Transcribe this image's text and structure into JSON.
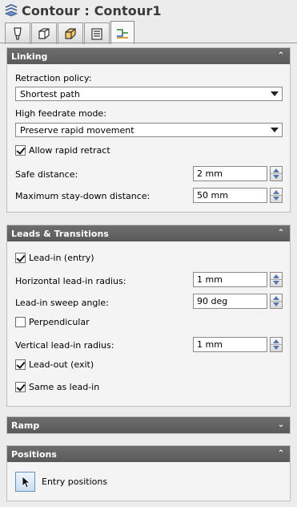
{
  "title": "Contour : Contour1",
  "tabs": [
    {
      "icon": "tool-icon",
      "active": false
    },
    {
      "icon": "stock-box-icon",
      "active": false
    },
    {
      "icon": "box-outline-icon",
      "active": false
    },
    {
      "icon": "passes-icon",
      "active": false
    },
    {
      "icon": "linking-icon",
      "active": true
    }
  ],
  "linking": {
    "header": "Linking",
    "retraction_label": "Retraction policy:",
    "retraction_value": "Shortest path",
    "high_feed_label": "High feedrate mode:",
    "high_feed_value": "Preserve rapid movement",
    "allow_rapid_label": "Allow rapid retract",
    "allow_rapid_checked": true,
    "safe_distance_label": "Safe distance:",
    "safe_distance_value": "2 mm",
    "max_stay_label": "Maximum stay-down distance:",
    "max_stay_value": "50 mm"
  },
  "leads": {
    "header": "Leads & Transitions",
    "lead_in_label": "Lead-in (entry)",
    "lead_in_checked": true,
    "h_radius_label": "Horizontal lead-in radius:",
    "h_radius_value": "1 mm",
    "sweep_label": "Lead-in sweep angle:",
    "sweep_value": "90 deg",
    "perpendicular_label": "Perpendicular",
    "perpendicular_checked": false,
    "v_radius_label": "Vertical lead-in radius:",
    "v_radius_value": "1 mm",
    "lead_out_label": "Lead-out (exit)",
    "lead_out_checked": true,
    "same_as_label": "Same as lead-in",
    "same_as_checked": true
  },
  "ramp": {
    "header": "Ramp"
  },
  "positions": {
    "header": "Positions",
    "entry_label": "Entry positions"
  }
}
